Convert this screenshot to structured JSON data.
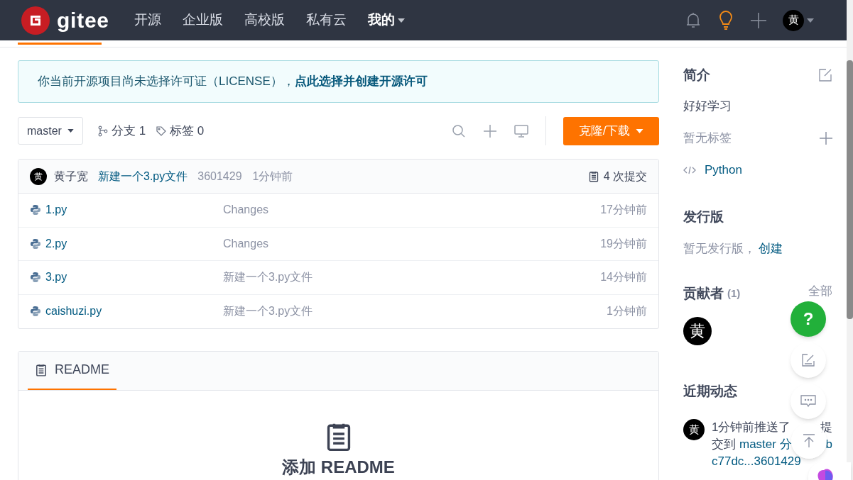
{
  "nav": {
    "logo": "gitee",
    "items": [
      {
        "label": "开源",
        "selected": false
      },
      {
        "label": "企业版",
        "selected": false
      },
      {
        "label": "高校版",
        "selected": false
      },
      {
        "label": "私有云",
        "selected": false
      },
      {
        "label": "我的",
        "selected": true
      }
    ],
    "avatar": "黄"
  },
  "notice": {
    "text": "你当前开源项目尚未选择许可证（LICENSE），",
    "link": "点此选择并创建开源许可"
  },
  "toolbar": {
    "branch": "master",
    "branches": "分支 1",
    "tags": "标签 0",
    "clone": "克隆/下载"
  },
  "commit": {
    "avatar": "黄",
    "author": "黄子宽",
    "message": "新建一个3.py文件",
    "hash": "3601429",
    "time": "1分钟前",
    "count": "4 次提交"
  },
  "files": [
    {
      "name": "1.py",
      "message": "Changes",
      "time": "17分钟前"
    },
    {
      "name": "2.py",
      "message": "Changes",
      "time": "19分钟前"
    },
    {
      "name": "3.py",
      "message": "新建一个3.py文件",
      "time": "14分钟前"
    },
    {
      "name": "caishuzi.py",
      "message": "新建一个3.py文件",
      "time": "1分钟前"
    }
  ],
  "readme": {
    "tab": "README",
    "heading": "添加 README"
  },
  "sidebar": {
    "intro_title": "简介",
    "description": "好好学习",
    "no_tags": "暂无标签",
    "language": "Python",
    "release_title": "发行版",
    "no_release": "暂无发行版，",
    "create": "创建",
    "contributors_title": "贡献者",
    "contributors_count": "(1)",
    "all": "全部",
    "contributor_avatar": "黄",
    "activity_title": "近期动态",
    "activity": {
      "avatar": "黄",
      "line1": "1分钟前推送了",
      "line1_tail": "提",
      "line2": "交到",
      "branch": "master 分",
      "line2_tail": "b",
      "hash": "c77dc...3601429"
    }
  },
  "float": {
    "help": "?"
  }
}
